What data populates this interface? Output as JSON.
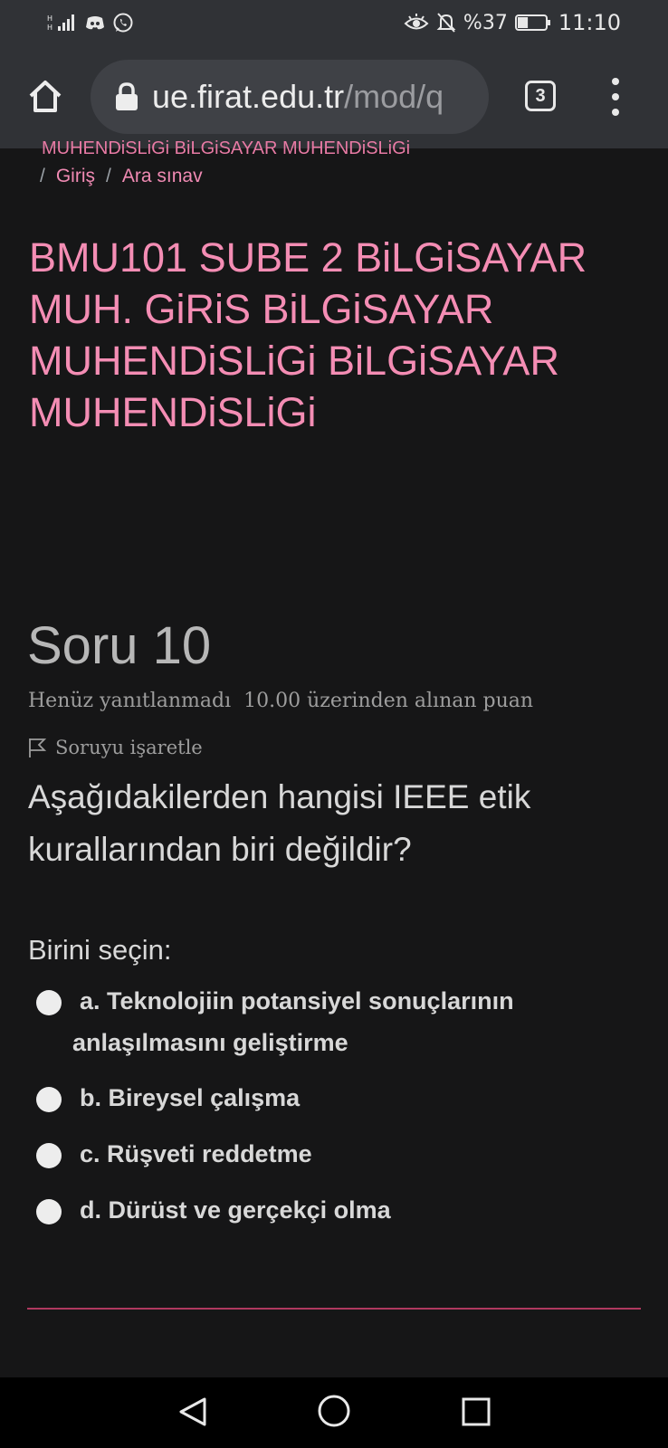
{
  "status_bar": {
    "battery_text": "%37",
    "battery_level": 0.37,
    "time": "11:10",
    "icons": [
      "signal-icon",
      "discord-icon",
      "whatsapp-icon",
      "eye-comfort-icon",
      "bell-off-icon",
      "battery-icon"
    ]
  },
  "browser": {
    "url_main": "ue.firat.edu.tr",
    "url_rest": "/mod/q",
    "tab_count": "3"
  },
  "breadcrumb": {
    "partial": "MUHENDiSLiGi BiLGiSAYAR MUHENDiSLiGi",
    "sep1": "/",
    "item1": "Giriş",
    "sep2": "/",
    "item2": "Ara sınav"
  },
  "course_title": "BMU101 SUBE 2 BiLGiSAYAR MUH. GiRiS BiLGiSAYAR MUHENDiSLiGi BiLGiSAYAR MUHENDiSLiGi",
  "question": {
    "number": "Soru 10",
    "status": "Henüz yanıtlanmadı",
    "grade": "10.00 üzerinden alınan puan",
    "flag_label": "Soruyu işaretle",
    "text": "Aşağıdakilerden hangisi IEEE etik kurallarından biri değildir?",
    "prompt": "Birini seçin:",
    "options": [
      {
        "line1": "a. Teknolojiin potansiyel sonuçlarının",
        "line2": "anlaşılmasını geliştirme"
      },
      {
        "line1": "b. Bireysel çalışma"
      },
      {
        "line1": "c. Rüşveti reddetme"
      },
      {
        "line1": "d. Dürüst ve gerçekçi olma"
      }
    ]
  },
  "colors": {
    "accent": "#f48db4",
    "background": "#161617",
    "toolbar": "#303236",
    "divider": "#b0395f"
  }
}
